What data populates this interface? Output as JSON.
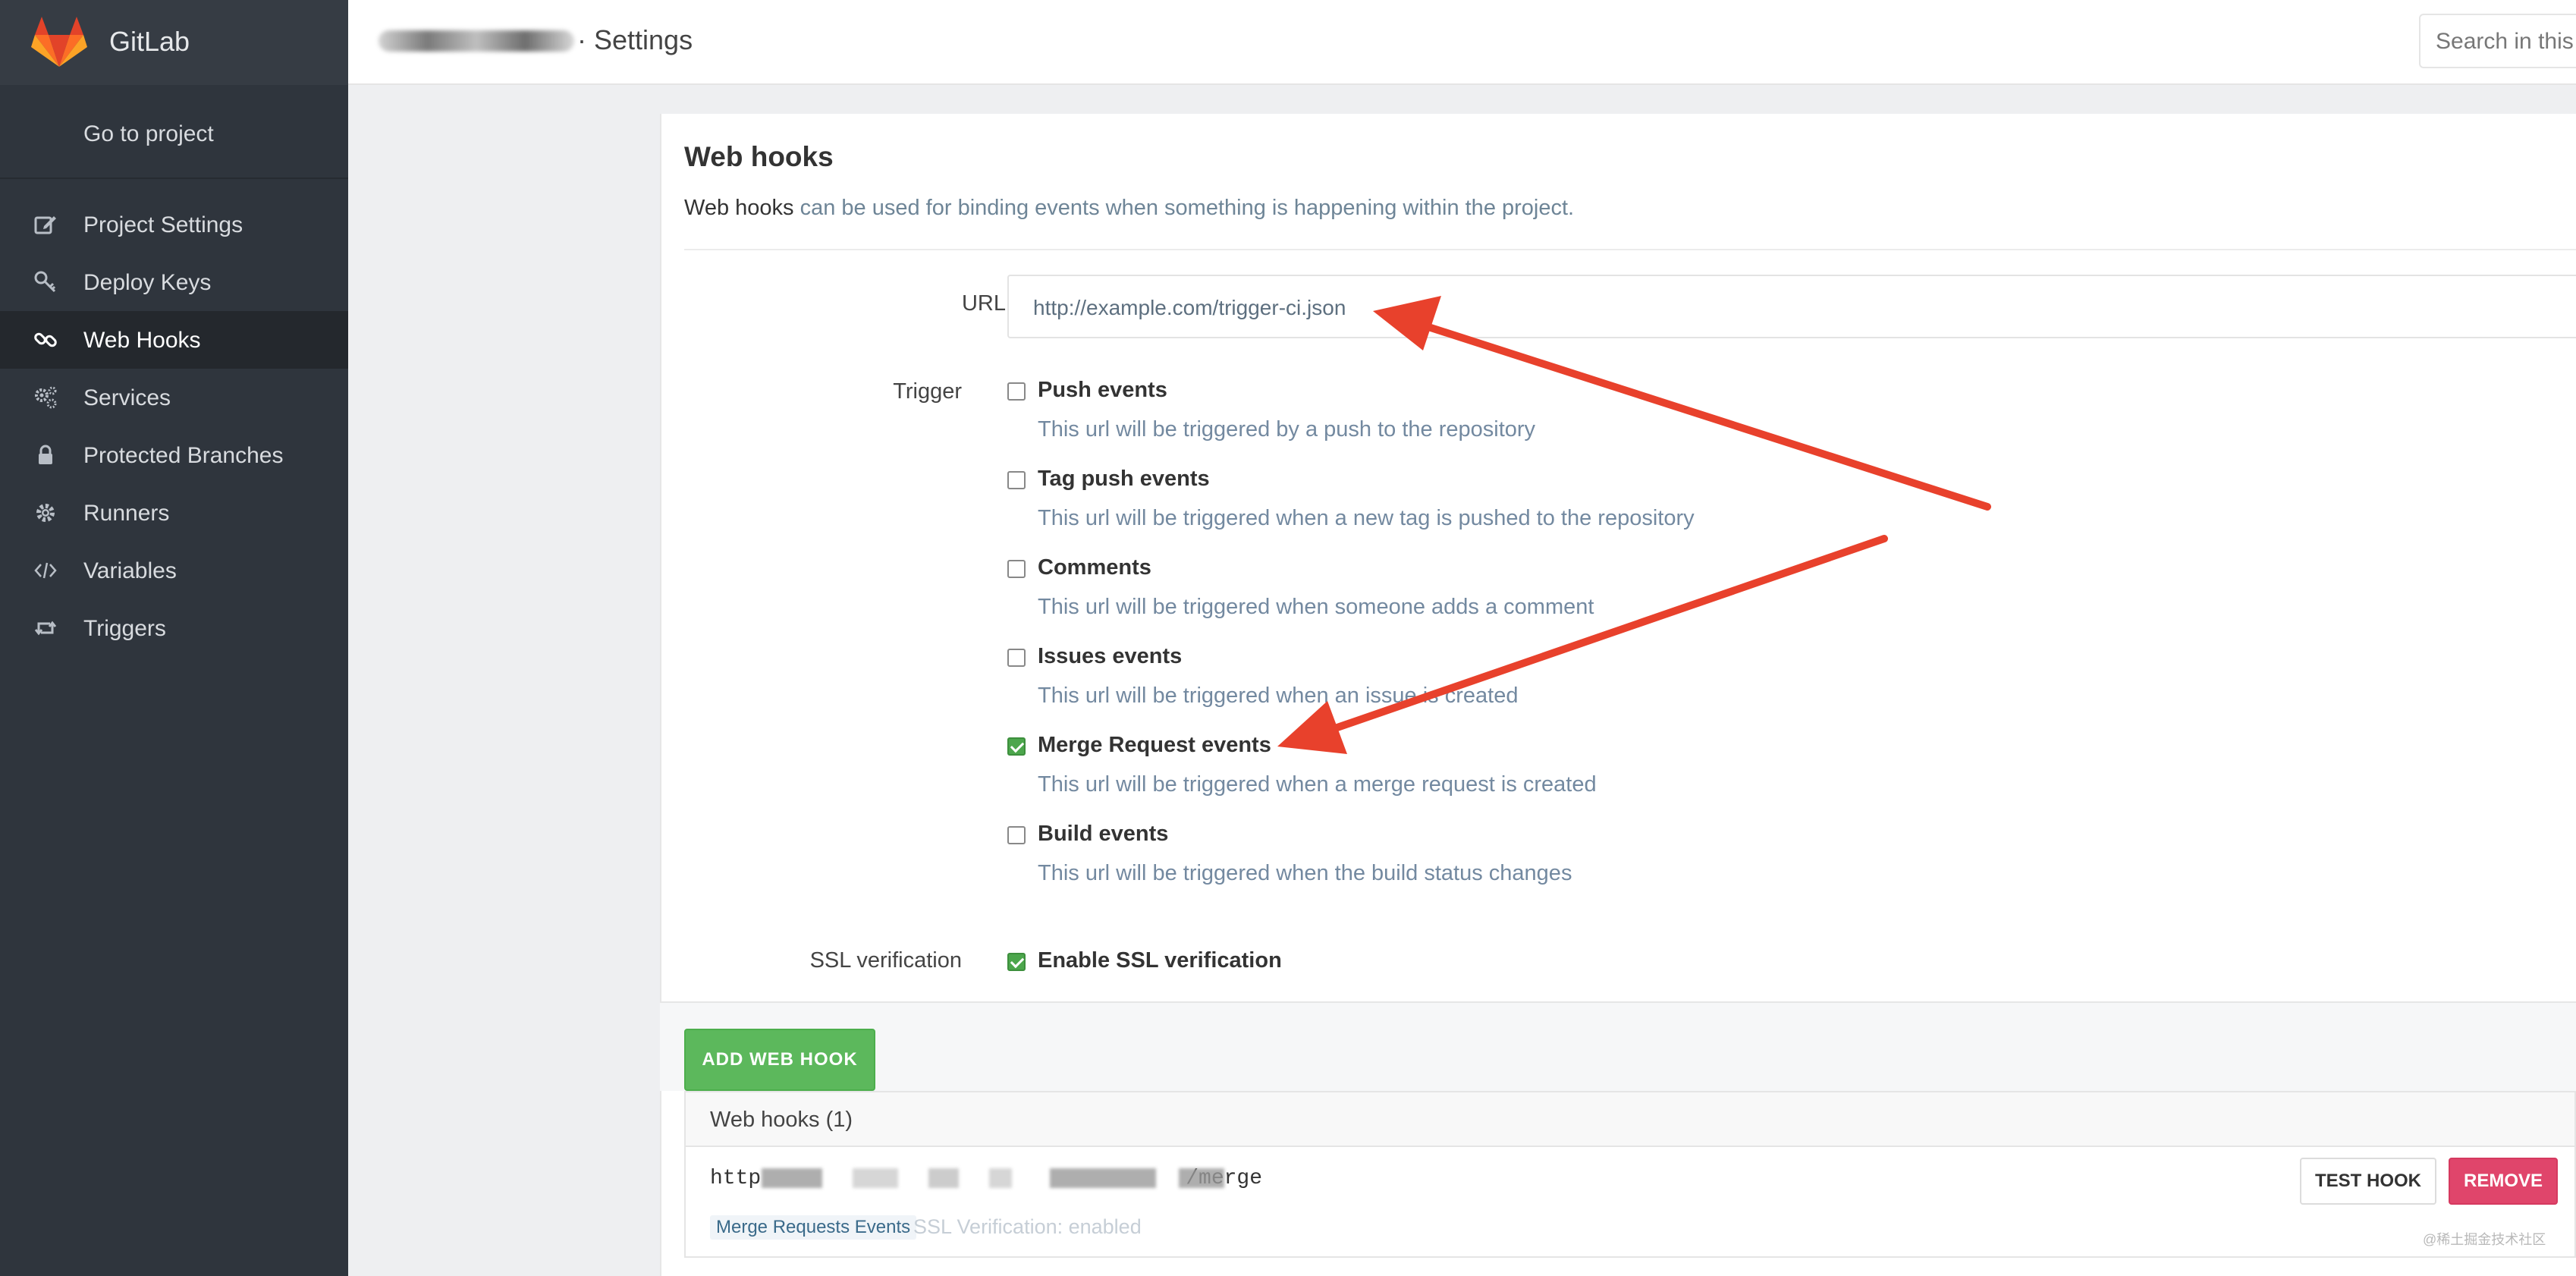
{
  "app": {
    "brand_name": "GitLab",
    "page_title": "· Settings",
    "search_placeholder": "Search in this"
  },
  "sidebar": {
    "go_to_project": "Go to project",
    "items": [
      {
        "label": "Project Settings",
        "icon": "edit-icon",
        "active": false
      },
      {
        "label": "Deploy Keys",
        "icon": "key-icon",
        "active": false
      },
      {
        "label": "Web Hooks",
        "icon": "link-icon",
        "active": true
      },
      {
        "label": "Services",
        "icon": "cogs-icon",
        "active": false
      },
      {
        "label": "Protected Branches",
        "icon": "lock-icon",
        "active": false
      },
      {
        "label": "Runners",
        "icon": "gear-icon",
        "active": false
      },
      {
        "label": "Variables",
        "icon": "code-icon",
        "active": false
      },
      {
        "label": "Triggers",
        "icon": "retweet-icon",
        "active": false
      }
    ]
  },
  "webhooks": {
    "title": "Web hooks",
    "desc_strong": "Web hooks",
    "desc_rest": " can be used for binding events when something is happening within the project.",
    "url_label": "URL",
    "url_placeholder": "http://example.com/trigger-ci.json",
    "trigger_label": "Trigger",
    "triggers": [
      {
        "label": "Push events",
        "help": "This url will be triggered by a push to the repository",
        "checked": false
      },
      {
        "label": "Tag push events",
        "help": "This url will be triggered when a new tag is pushed to the repository",
        "checked": false
      },
      {
        "label": "Comments",
        "help": "This url will be triggered when someone adds a comment",
        "checked": false
      },
      {
        "label": "Issues events",
        "help": "This url will be triggered when an issue is created",
        "checked": false
      },
      {
        "label": "Merge Request events",
        "help": "This url will be triggered when a merge request is created",
        "checked": true
      },
      {
        "label": "Build events",
        "help": "This url will be triggered when the build status changes",
        "checked": false
      }
    ],
    "ssl_label": "SSL verification",
    "ssl_option": "Enable SSL verification",
    "ssl_checked": true,
    "add_button": "ADD WEB HOOK",
    "list_title": "Web hooks (1)",
    "hook": {
      "url_start": "http",
      "url_end": "/merge",
      "badge": "Merge Requests Events",
      "ssl_note": "SSL Verification: enabled",
      "test_button": "TEST HOOK",
      "remove_button": "REMOVE"
    }
  },
  "watermark": "@稀土掘金技术社区",
  "colors": {
    "sidebar_bg": "#2f353d",
    "active_item": "#24282d",
    "add_button": "#5cb85c",
    "remove_button": "#e0456b",
    "annotation_arrow": "#e8412c"
  }
}
